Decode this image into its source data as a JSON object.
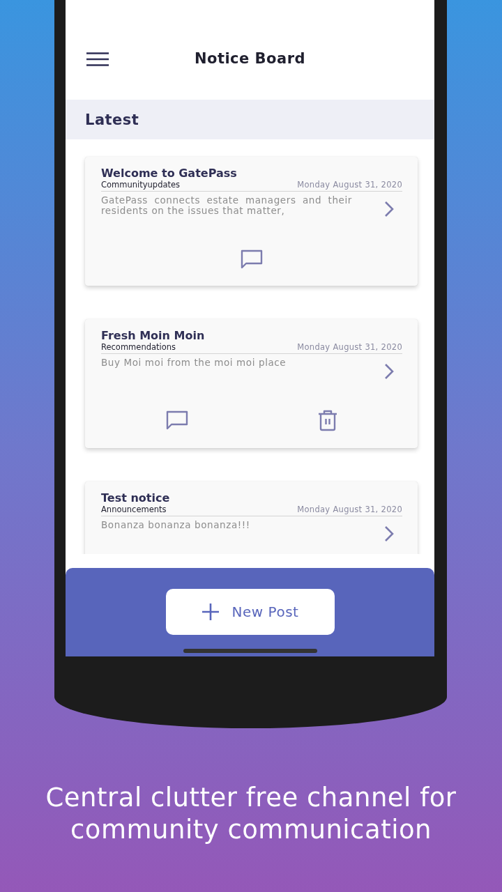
{
  "header": {
    "title": "Notice Board"
  },
  "section": {
    "title": "Latest"
  },
  "notices": [
    {
      "title": "Welcome to GatePass",
      "category": "Communityupdates",
      "date": "Monday August 31, 2020",
      "body": "GatePass connects estate managers and their residents on the issues that matter,",
      "actions": [
        {
          "kind": "comment"
        }
      ]
    },
    {
      "title": "Fresh Moin Moin",
      "category": "Recommendations",
      "date": "Monday August 31, 2020",
      "body": "Buy Moi moi from the moi moi place",
      "actions": [
        {
          "kind": "comment"
        },
        {
          "kind": "delete"
        }
      ]
    },
    {
      "title": "Test notice",
      "category": "Announcements",
      "date": "Monday August 31, 2020",
      "body": "Bonanza bonanza bonanza!!!"
    }
  ],
  "new_post_button": {
    "label": "New Post"
  },
  "caption": "Central clutter free channel for community communication"
}
